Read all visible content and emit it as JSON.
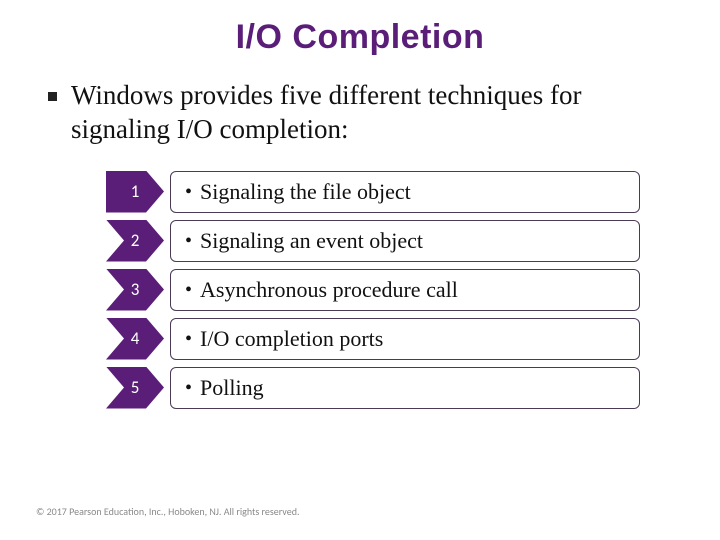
{
  "title": "I/O Completion",
  "intro": "Windows provides five different techniques for signaling I/O completion:",
  "items": [
    {
      "num": "1",
      "text": "Signaling the file object"
    },
    {
      "num": "2",
      "text": "Signaling an event object"
    },
    {
      "num": "3",
      "text": "Asynchronous procedure call"
    },
    {
      "num": "4",
      "text": "I/O completion ports"
    },
    {
      "num": "5",
      "text": "Polling"
    }
  ],
  "footer": "© 2017 Pearson Education, Inc., Hoboken, NJ. All rights reserved."
}
